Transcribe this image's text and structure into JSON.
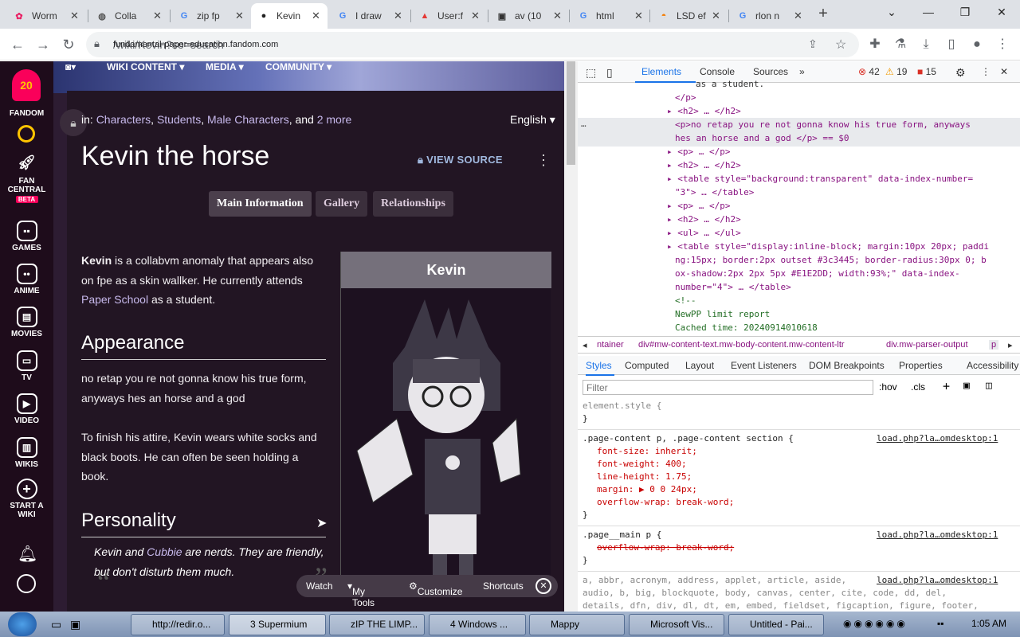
{
  "tabs": [
    {
      "label": "Worm",
      "fav": "✿",
      "favc": "#e91e63"
    },
    {
      "label": "Colla",
      "fav": "🌐",
      "favc": "#555"
    },
    {
      "label": "zip fp",
      "fav": "G",
      "favc": "#4285f4"
    },
    {
      "label": "Kevin",
      "fav": "●",
      "favc": "#222"
    },
    {
      "label": "I draw",
      "fav": "G",
      "favc": "#4285f4"
    },
    {
      "label": "User:f",
      "fav": "▲",
      "favc": "#e53935"
    },
    {
      "label": "av (10",
      "fav": "▣",
      "favc": "#333"
    },
    {
      "label": "html",
      "fav": "G",
      "favc": "#4285f4"
    },
    {
      "label": "LSD ef",
      "fav": "◓",
      "favc": "#f57c00"
    },
    {
      "label": "rlon n",
      "fav": "G",
      "favc": "#4285f4"
    }
  ],
  "address": {
    "domain": "fundamental-paper-education.fandom.com",
    "path": "/wiki/Kevin?so=search"
  },
  "rail": {
    "logo": "20",
    "brand": "FANDOM",
    "fan_central": "FAN CENTRAL",
    "beta": "BETA",
    "games": "GAMES",
    "anime": "ANIME",
    "movies": "MOVIES",
    "tv": "TV",
    "video": "VIDEO",
    "wikis": "WIKIS",
    "start_wiki": "START A WIKI"
  },
  "banner": {
    "wiki_content": "WIKI CONTENT",
    "media": "MEDIA",
    "community": "COMMUNITY"
  },
  "article": {
    "cats_prefix": "in: ",
    "cat1": "Characters",
    "cat2": "Students",
    "cat3": "Male Characters",
    "cats_and": ", and ",
    "cats_more": "2 more",
    "language": "English",
    "title": "Kevin the horse",
    "view_source": "VIEW SOURCE",
    "tabs": [
      "Main Information",
      "Gallery",
      "Relationships"
    ],
    "intro_bold": "Kevin",
    "intro_1": " is a collabvm anomaly that appears also on fpe as a skin wallker. He currently attends ",
    "intro_link": "Paper School",
    "intro_2": " as a student.",
    "h_appearance": "Appearance",
    "appearance_1": "no retap you re not gonna know his true form, anyways hes an horse and a god",
    "appearance_2": "To finish his attire, Kevin wears white socks and black boots. He can often be seen holding a book.",
    "h_personality": "Personality",
    "quote_1": "Kevin and ",
    "quote_link": "Cubbie",
    "quote_2": " are nerds. They are friendly, but don't disturb them much.",
    "infobox_title": "Kevin"
  },
  "page_toolbar": {
    "watch": "Watch",
    "mytools": "My Tools",
    "customize": "Customize",
    "shortcuts": "Shortcuts"
  },
  "devtools": {
    "tabs": [
      "Elements",
      "Console",
      "Sources"
    ],
    "errors": "42",
    "warnings": "19",
    "issues": "15",
    "dom": [
      "as a student.",
      "</p>",
      "<h2> … </h2>",
      "<p>no retap you re not gonna know his true form, anyways",
      "hes an horse and a god </p> == $0",
      "<p> … </p>",
      "<h2> … </h2>",
      "<table style=\"background:transparent\" data-index-number=",
      "\"3\"> … </table>",
      "<p> … </p>",
      "<h2> … </h2>",
      "<ul> … </ul>",
      "<table style=\"display:inline-block; margin:10px 20px; paddi",
      "ng:15px; border:2px outset #3c3445; border-radius:30px 0; b",
      "ox-shadow:2px 2px 5px #E1E2DD; width:93%;\" data-index-",
      "number=\"4\"> … </table>",
      "<!--",
      "NewPP limit report",
      "Cached time: 20240914010618"
    ],
    "breadcrumbs": [
      "ntainer",
      "div#mw-content-text.mw-body-content.mw-content-ltr",
      "div.mw-parser-output",
      "p"
    ],
    "style_tabs": [
      "Styles",
      "Computed",
      "Layout",
      "Event Listeners",
      "DOM Breakpoints",
      "Properties",
      "Accessibility"
    ],
    "filter_placeholder": "Filter",
    "hov": ":hov",
    "cls": ".cls",
    "css": {
      "element_style": "element.style {",
      "close": "}",
      "rule1_sel": ".page-content p, .page-content section {",
      "rule1_src": "load.php?la…omdesktop:1",
      "rule1_p1": "font-size: inherit;",
      "rule1_p2": "font-weight: 400;",
      "rule1_p3": "line-height: 1.75;",
      "rule1_p4": "margin: ▶ 0 0 24px;",
      "rule1_p5": "overflow-wrap: break-word;",
      "rule2_sel": ".page__main p {",
      "rule2_src": "load.php?la…omdesktop:1",
      "rule2_p1": "overflow-wrap: break-word;",
      "rule3_src": "load.php?la…omdesktop:1",
      "rule3_l1": "a, abbr, acronym, address, applet, article, aside,",
      "rule3_l2": "audio, b, big, blockquote, body, canvas, center, cite, code, dd, del,",
      "rule3_l3": "details, dfn, div, dl, dt, em, embed, fieldset, figcaption, figure, footer,"
    }
  },
  "taskbar": {
    "items": [
      "http://redir.o...",
      "3 Supermium",
      "zIP THE LIMP...",
      "4 Windows ...",
      "Mappy",
      "Microsoft Vis...",
      "Untitled - Pai..."
    ],
    "clock": "1:05 AM"
  }
}
